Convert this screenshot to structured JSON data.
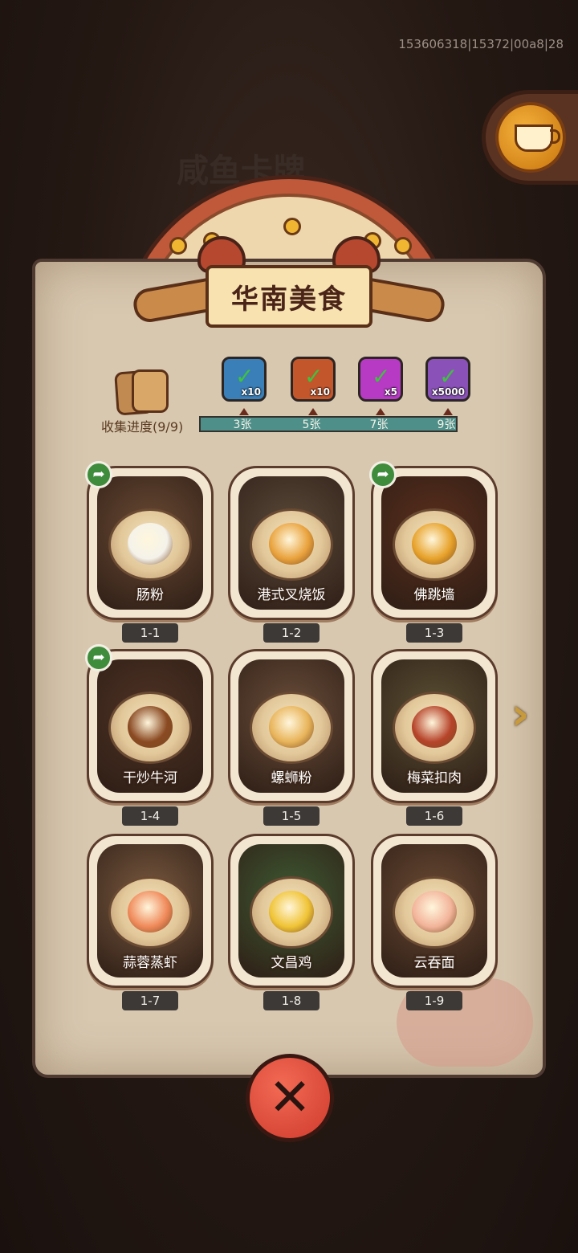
{
  "debug_id": "153606318|15372|00a8|28",
  "header": {
    "dim_title": "咸鱼卡牌"
  },
  "banner": {
    "title": "华南美食"
  },
  "progress": {
    "label": "收集进度(9/9)",
    "collected": 9,
    "total": 9,
    "milestones": [
      {
        "label": "3张",
        "reward_qty": "x10",
        "claimed": true,
        "reward_icon": "chest-icon",
        "color": "#3a7fb8"
      },
      {
        "label": "5张",
        "reward_qty": "x10",
        "claimed": true,
        "reward_icon": "key-icon",
        "color": "#c4562c"
      },
      {
        "label": "7张",
        "reward_qty": "x5",
        "claimed": true,
        "reward_icon": "gem-icon",
        "color": "#b63ac4"
      },
      {
        "label": "9张",
        "reward_qty": "x5000",
        "claimed": true,
        "reward_icon": "ticket-icon",
        "color": "#8a52b8"
      }
    ]
  },
  "cards": [
    {
      "id": "1-1",
      "name": "肠粉",
      "shared": true,
      "food_color": "#f4f2ea",
      "bg": "#6a4a34"
    },
    {
      "id": "1-2",
      "name": "港式叉烧饭",
      "shared": false,
      "food_color": "#e9a23c",
      "bg": "#5a4a3a"
    },
    {
      "id": "1-3",
      "name": "佛跳墙",
      "shared": true,
      "food_color": "#e7a22a",
      "bg": "#5a2e1c"
    },
    {
      "id": "1-4",
      "name": "干炒牛河",
      "shared": true,
      "food_color": "#8a4a22",
      "bg": "#4e3224"
    },
    {
      "id": "1-5",
      "name": "螺蛳粉",
      "shared": false,
      "food_color": "#e8b45a",
      "bg": "#6a4e3a"
    },
    {
      "id": "1-6",
      "name": "梅菜扣肉",
      "shared": false,
      "food_color": "#b6442a",
      "bg": "#5a5034"
    },
    {
      "id": "1-7",
      "name": "蒜蓉蒸虾",
      "shared": false,
      "food_color": "#f08a5a",
      "bg": "#7a5a40"
    },
    {
      "id": "1-8",
      "name": "文昌鸡",
      "shared": false,
      "food_color": "#f0c436",
      "bg": "#3e5a32"
    },
    {
      "id": "1-9",
      "name": "云吞面",
      "shared": false,
      "food_color": "#f2b49a",
      "bg": "#6a4a34"
    }
  ],
  "icons": {
    "share": "share-arrow-icon",
    "next": "next-page-arrow-icon",
    "close": "close-x-icon",
    "menu_cup": "coffee-cup-icon"
  },
  "colors": {
    "close_button": "#e4503e",
    "progress_track": "#4f8f8a",
    "parchment": "#d8c8b0"
  }
}
